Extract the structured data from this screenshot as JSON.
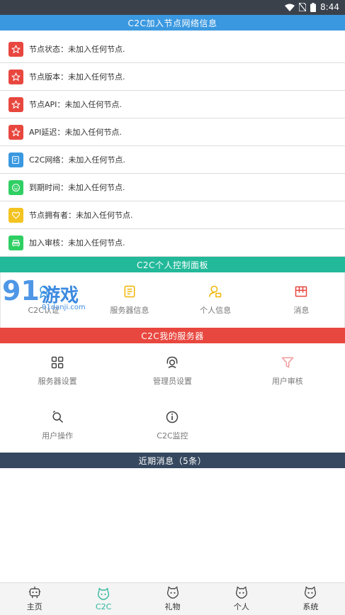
{
  "status_bar": {
    "time": "8:44",
    "icons": [
      "wifi-icon",
      "sim-off-icon",
      "battery-icon"
    ]
  },
  "join_section": {
    "title": "C2C加入节点网络信息",
    "rows": [
      {
        "label": "节点状态：未加入任何节点.",
        "icon": "star-icon",
        "color": "#e8473f"
      },
      {
        "label": "节点版本：未加入任何节点.",
        "icon": "star-icon",
        "color": "#e8473f"
      },
      {
        "label": "节点API：未加入任何节点.",
        "icon": "star-icon",
        "color": "#e8473f"
      },
      {
        "label": "API延迟：未加入任何节点.",
        "icon": "star-icon",
        "color": "#e8473f"
      },
      {
        "label": "C2C网络：未加入任何节点.",
        "icon": "edit-icon",
        "color": "#3a98e0"
      },
      {
        "label": "到期时间：未加入任何节点.",
        "icon": "smile-icon",
        "color": "#2fcf63"
      },
      {
        "label": "节点拥有者：未加入任何节点.",
        "icon": "heart-icon",
        "color": "#f3c321"
      },
      {
        "label": "加入审核：未加入任何节点.",
        "icon": "sofa-icon",
        "color": "#2fcf63"
      }
    ]
  },
  "panel_section": {
    "title": "C2C个人控制面板",
    "items": [
      {
        "label": "C2C认证",
        "icon": "badge-icon"
      },
      {
        "label": "服务器信息",
        "icon": "server-info-icon"
      },
      {
        "label": "个人信息",
        "icon": "user-icon"
      },
      {
        "label": "消息",
        "icon": "message-box-icon"
      }
    ]
  },
  "watermark": {
    "logo": "91",
    "word": "游戏",
    "url": "91danji.com"
  },
  "server_section": {
    "title": "C2C我的服务器",
    "rows": [
      [
        {
          "label": "服务器设置",
          "icon": "grid-icon"
        },
        {
          "label": "管理员设置",
          "icon": "headset-icon"
        },
        {
          "label": "用户审核",
          "icon": "filter-icon"
        }
      ],
      [
        {
          "label": "用户操作",
          "icon": "user-operate-icon"
        },
        {
          "label": "C2C监控",
          "icon": "info-icon"
        }
      ]
    ]
  },
  "recent_section": {
    "title": "近期消息（5条）"
  },
  "tabbar": {
    "tabs": [
      {
        "label": "主页",
        "icon": "robot-home-icon",
        "active": false
      },
      {
        "label": "C2C",
        "icon": "cat-c2c-icon",
        "active": true
      },
      {
        "label": "礼物",
        "icon": "cat-gift-icon",
        "active": false
      },
      {
        "label": "个人",
        "icon": "cat-person-icon",
        "active": false
      },
      {
        "label": "系统",
        "icon": "cat-system-icon",
        "active": false
      }
    ]
  },
  "colors": {
    "blue": "#3a98e0",
    "green": "#22b99a",
    "red": "#e8473f",
    "dark": "#36485f",
    "accent": "#2bb59a"
  }
}
